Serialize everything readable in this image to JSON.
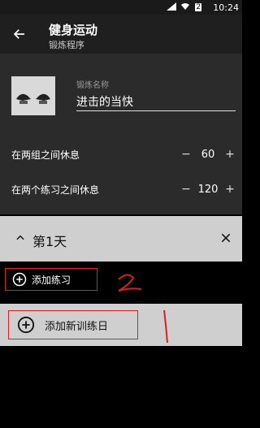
{
  "status": {
    "time": "10:24",
    "battery_level": "2"
  },
  "header": {
    "title": "健身运动",
    "subtitle": "锻炼程序"
  },
  "form": {
    "name_label": "锻炼名称",
    "name_value": "进击的当快"
  },
  "rests": [
    {
      "label": "在两组之间休息",
      "value": "60"
    },
    {
      "label": "在两个练习之间休息",
      "value": "120"
    }
  ],
  "day": {
    "title": "第1天"
  },
  "actions": {
    "add_exercise": "添加练习",
    "add_day": "添加新训练日"
  },
  "annotations": {
    "mark_two": "2",
    "mark_one": "1"
  },
  "colors": {
    "annotation": "#d22222"
  }
}
